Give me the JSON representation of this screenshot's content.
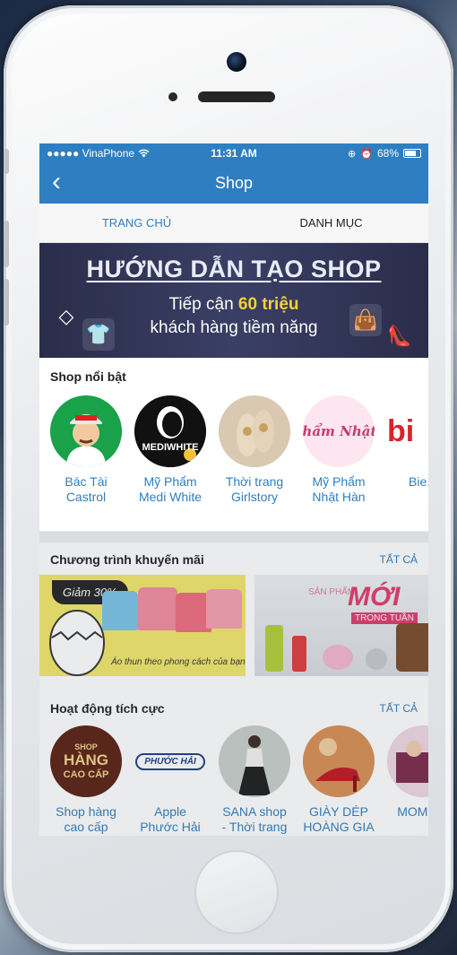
{
  "status_bar": {
    "carrier": "●●●●● VinaPhone",
    "time": "11:31 AM",
    "battery": "68%"
  },
  "navbar": {
    "back_glyph": "‹",
    "title": "Shop"
  },
  "tabs": [
    {
      "label": "TRANG CHỦ",
      "active": true
    },
    {
      "label": "DANH MỤC",
      "active": false
    }
  ],
  "banner": {
    "headline": "HƯỚNG DẪN TẠO SHOP",
    "line2_pre": "Tiếp cận ",
    "line2_highlight": "60 triệu",
    "line3": "khách hàng tiềm năng"
  },
  "featured": {
    "title": "Shop nổi bật",
    "shops": [
      {
        "name": "Bác Tài Castrol",
        "icon": "driver-avatar-icon"
      },
      {
        "name": "Mỹ Phẩm Medi White",
        "logo_text": "MEDIWHITE"
      },
      {
        "name": "Thời trang Girlstory",
        "icon": "shoes-photo-icon"
      },
      {
        "name": "Mỹ Phẩm Nhật Hàn",
        "logo_text": "Mỹ Phẩm Nhật Hàn"
      },
      {
        "name": "Bie...",
        "logo_text": "bi"
      }
    ]
  },
  "promotions": {
    "title": "Chương trình khuyến mãi",
    "see_all": "TẤT CẢ",
    "items": [
      {
        "badge": "Giảm 30%",
        "caption": "Áo thun theo phong cách của bạn"
      },
      {
        "small": "SẢN PHẨM",
        "big": "MỚI",
        "sub": "TRONG TUẦN"
      }
    ]
  },
  "active": {
    "title": "Hoạt động tích cực",
    "see_all": "TẤT CẢ",
    "shops": [
      {
        "name": "Shop hàng cao cấp",
        "logo_lines": [
          "SHOP",
          "HÀNG",
          "CAO CẤP"
        ]
      },
      {
        "name": "Apple Phước Hải",
        "logo_text": "PHƯỚC HẢI"
      },
      {
        "name": "SANA shop - Thời trang",
        "icon": "model-photo-icon"
      },
      {
        "name": "GIÀY DÉP HOÀNG GIA",
        "icon": "heels-photo-icon"
      },
      {
        "name": "MOM CA",
        "icon": "mom-photo-icon"
      }
    ]
  },
  "colors": {
    "primary": "#2e7fc1",
    "banner_bg": "#2a2d4a",
    "highlight": "#f4d23a"
  }
}
